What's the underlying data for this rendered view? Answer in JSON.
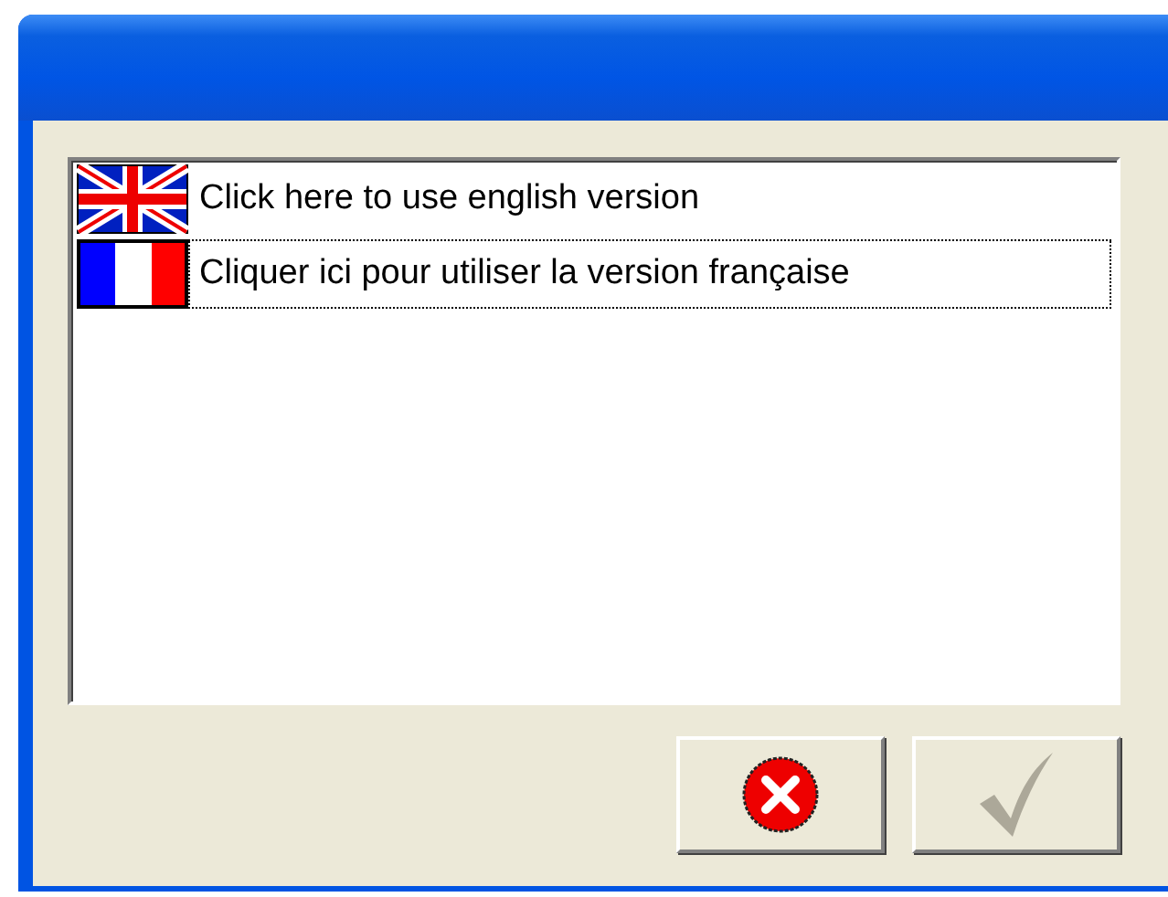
{
  "languages": [
    {
      "kind": "uk",
      "label": "Click here to use english version",
      "focused": false
    },
    {
      "kind": "fr",
      "label": "Cliquer ici pour utiliser la version française",
      "focused": true
    }
  ],
  "buttons": [
    {
      "kind": "cancel",
      "disabled": false
    },
    {
      "kind": "ok",
      "disabled": true
    }
  ]
}
